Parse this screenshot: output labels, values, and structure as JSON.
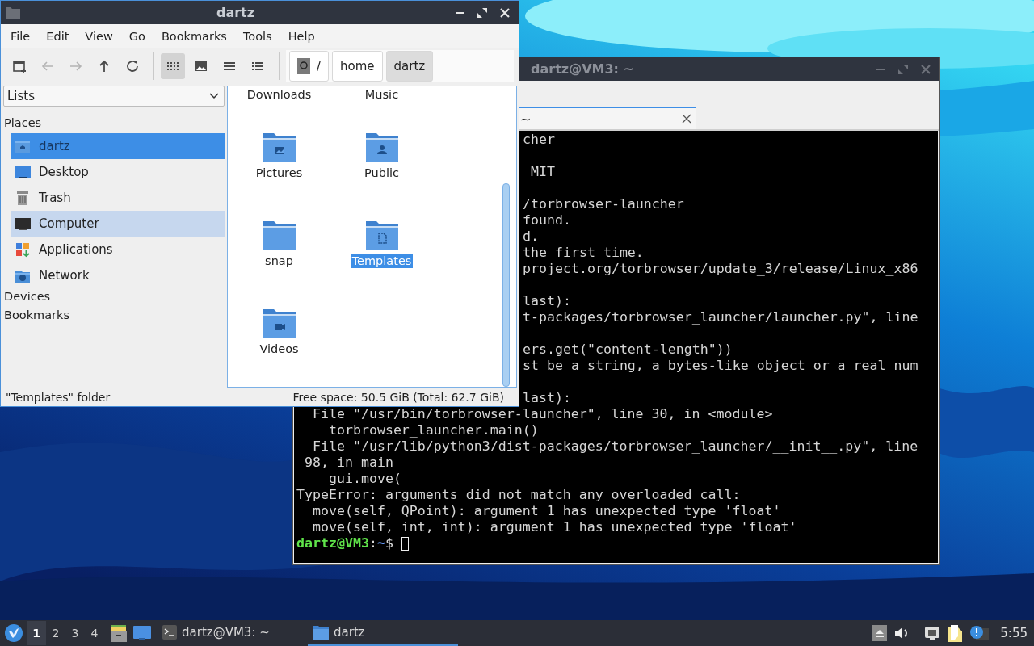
{
  "file_manager": {
    "title": "dartz",
    "menu": [
      "File",
      "Edit",
      "View",
      "Go",
      "Bookmarks",
      "Tools",
      "Help"
    ],
    "nav_buttons": [
      {
        "kind": "new-tab",
        "disabled": false
      },
      {
        "kind": "back",
        "disabled": true
      },
      {
        "kind": "forward",
        "disabled": true
      },
      {
        "kind": "up",
        "disabled": false
      },
      {
        "kind": "reload",
        "disabled": false
      }
    ],
    "view_modes": [
      {
        "kind": "icons",
        "selected": true
      },
      {
        "kind": "thumbnails",
        "selected": false
      },
      {
        "kind": "compact",
        "selected": false
      },
      {
        "kind": "detailed",
        "selected": false
      }
    ],
    "path": [
      {
        "label": "/",
        "kind": "root",
        "selected": false
      },
      {
        "label": "home",
        "kind": "dir",
        "selected": false
      },
      {
        "label": "dartz",
        "kind": "dir",
        "selected": true
      }
    ],
    "side_pane_mode": "Lists",
    "sidebar": [
      {
        "title": "Places",
        "items": [
          {
            "label": "dartz",
            "kind": "home",
            "selected": true,
            "hovered": false
          },
          {
            "label": "Desktop",
            "kind": "desktop",
            "selected": false,
            "hovered": false
          },
          {
            "label": "Trash",
            "kind": "trash",
            "selected": false,
            "hovered": false
          },
          {
            "label": "Computer",
            "kind": "computer",
            "selected": false,
            "hovered": true
          },
          {
            "label": "Applications",
            "kind": "apps",
            "selected": false,
            "hovered": false
          },
          {
            "label": "Network",
            "kind": "network",
            "selected": false,
            "hovered": false
          }
        ]
      },
      {
        "title": "Devices"
      },
      {
        "title": "Bookmarks"
      }
    ],
    "files": [
      {
        "name": "Downloads",
        "kind": "text-only",
        "selected": false
      },
      {
        "name": "Music",
        "kind": "text-only",
        "selected": false
      },
      {
        "name": "Pictures",
        "kind": "pictures",
        "selected": false
      },
      {
        "name": "Public",
        "kind": "public",
        "selected": false
      },
      {
        "name": "snap",
        "kind": "plain",
        "selected": false
      },
      {
        "name": "Templates",
        "kind": "templates",
        "selected": true
      },
      {
        "name": "Videos",
        "kind": "videos",
        "selected": false
      }
    ],
    "status": {
      "selection": "\"Templates\" folder",
      "free_space": "Free space: 50.5 GiB (Total: 62.7 GiB)"
    }
  },
  "terminal": {
    "title": "dartz@VM3: ~",
    "tab": "~",
    "clipped_blocks": [
      [
        "cher"
      ],
      [
        " MIT"
      ],
      [
        "/torbrowser-launcher",
        "found.",
        "d.",
        "the first time.",
        "project.org/torbrowser/update_3/release/Linux_x86"
      ],
      [
        "last):",
        "t-packages/torbrowser_launcher/launcher.py\", line"
      ],
      [
        "ers.get(\"content-length\"))",
        "st be a string, a bytes-like object or a real num"
      ],
      [
        "last):"
      ]
    ],
    "lines": [
      "  File \"/usr/bin/torbrowser-launcher\", line 30, in <module>",
      "    torbrowser_launcher.main()",
      "  File \"/usr/lib/python3/dist-packages/torbrowser_launcher/__init__.py\", line",
      " 98, in main",
      "    gui.move(",
      "TypeError: arguments did not match any overloaded call:",
      "  move(self, QPoint): argument 1 has unexpected type 'float'",
      "  move(self, int, int): argument 1 has unexpected type 'float'"
    ],
    "prompt": {
      "user": "dartz@VM3",
      "separator": ":",
      "path": "~",
      "symbol": "$"
    }
  },
  "taskbar": {
    "workspaces": [
      {
        "label": "1",
        "selected": true
      },
      {
        "label": "2",
        "selected": false
      },
      {
        "label": "3",
        "selected": false
      },
      {
        "label": "4",
        "selected": false
      }
    ],
    "tasks": [
      {
        "label": "dartz@VM3: ~",
        "kind": "terminal",
        "selected": false
      },
      {
        "label": "dartz",
        "kind": "folder",
        "selected": true
      }
    ],
    "clock": "5:55"
  }
}
